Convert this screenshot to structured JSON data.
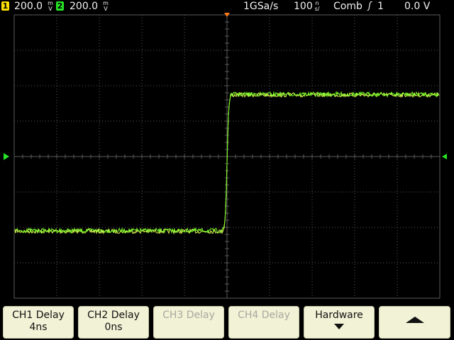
{
  "status_bar": {
    "ch1": {
      "number": "1",
      "scale": "200.0",
      "unit_top": "m",
      "unit_bottom": "V",
      "color": "#ffe000"
    },
    "ch2": {
      "number": "2",
      "scale": "200.0",
      "unit_top": "m",
      "unit_bottom": "V",
      "color": "#26e626"
    },
    "sample_rate": "1GSa/s",
    "timebase": "100",
    "timebase_unit_top": "n",
    "timebase_unit_bottom": "s/",
    "trigger_mode": "Comb",
    "trigger_edge_icon": "rising-edge-icon",
    "trigger_edge_glyph": "ʃ",
    "trigger_source": "1",
    "trigger_level": "0.0 V"
  },
  "display": {
    "trace_color": "#7cff2a",
    "trace_color_alt": "#e6ff5a",
    "grid_color": "#5a5a5a",
    "trigger_marker_color": "#ff7a1a",
    "ground_marker_color": "#26e626",
    "waveform": {
      "low_level_div": -2.1,
      "high_level_div": 1.75,
      "edge_time_div": 0.0
    }
  },
  "softkeys": {
    "ch1_delay": {
      "label": "CH1 Delay",
      "value": "4ns"
    },
    "ch2_delay": {
      "label": "CH2 Delay",
      "value": "0ns"
    },
    "ch3_delay": {
      "label": "CH3 Delay"
    },
    "ch4_delay": {
      "label": "CH4 Delay"
    },
    "hardware": {
      "label": "Hardware"
    }
  }
}
